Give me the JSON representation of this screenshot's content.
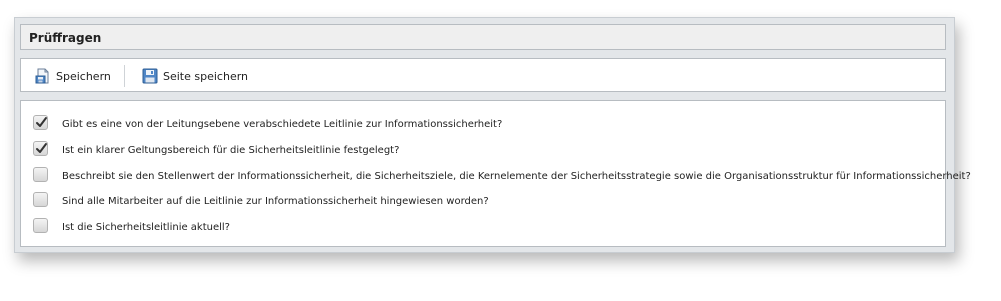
{
  "panel": {
    "title": "Prüffragen"
  },
  "toolbar": {
    "save_label": "Speichern",
    "save_page_label": "Seite speichern",
    "save_icon": "save-document-icon",
    "save_page_icon": "floppy-disk-icon"
  },
  "questions": [
    {
      "text": "Gibt es eine von der Leitungsebene verabschiedete Leitlinie zur Informationssicherheit?",
      "checked": true
    },
    {
      "text": "Ist ein klarer Geltungsbereich für die Sicherheitsleitlinie festgelegt?",
      "checked": true
    },
    {
      "text": "Beschreibt sie den Stellenwert der Informationssicherheit, die Sicherheitsziele, die Kernelemente der Sicherheitsstrategie sowie die Organisationsstruktur für Informationssicherheit?",
      "checked": false
    },
    {
      "text": "Sind alle Mitarbeiter auf die Leitlinie zur Informationssicherheit hingewiesen worden?",
      "checked": false
    },
    {
      "text": "Ist die Sicherheitsleitlinie aktuell?",
      "checked": false
    }
  ]
}
